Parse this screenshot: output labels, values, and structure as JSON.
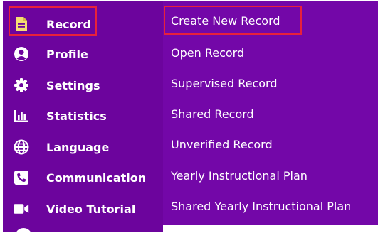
{
  "colors": {
    "sidebar_bg": "#6c049d",
    "submenu_bg": "#7307a8",
    "highlight_border": "#e8213b",
    "record_icon_color": "#f5dd73",
    "text": "#ffffff"
  },
  "sidebar": {
    "items": [
      {
        "label": "Record",
        "icon": "document-icon",
        "active": true
      },
      {
        "label": "Profile",
        "icon": "user-circle-icon"
      },
      {
        "label": "Settings",
        "icon": "gear-icon"
      },
      {
        "label": "Statistics",
        "icon": "bar-chart-icon"
      },
      {
        "label": "Language",
        "icon": "globe-icon"
      },
      {
        "label": "Communication",
        "icon": "phone-icon"
      },
      {
        "label": "Video Tutorial",
        "icon": "video-camera-icon"
      }
    ]
  },
  "submenu": {
    "items": [
      {
        "label": "Create New Record",
        "highlighted": true
      },
      {
        "label": "Open Record"
      },
      {
        "label": "Supervised Record"
      },
      {
        "label": "Shared Record"
      },
      {
        "label": "Unverified Record"
      },
      {
        "label": "Yearly Instructional Plan"
      },
      {
        "label": "Shared Yearly Instructional Plan"
      }
    ]
  }
}
